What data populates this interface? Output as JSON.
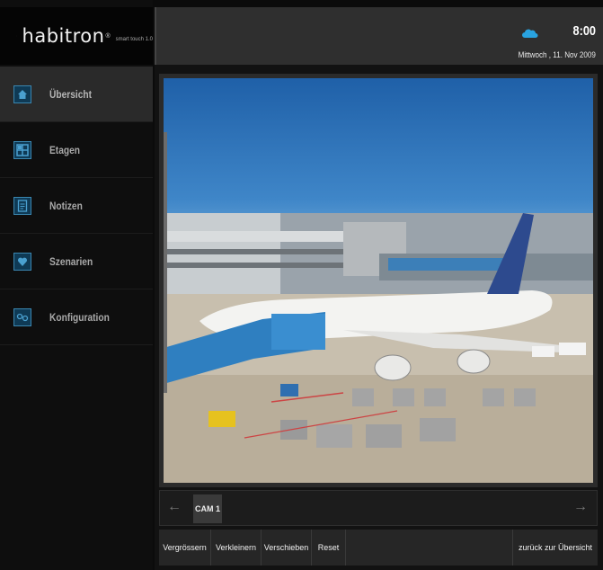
{
  "app": {
    "logo_text": "habitron",
    "logo_reg": "®",
    "logo_sub": "smart touch 1.0"
  },
  "sidebar": {
    "items": [
      {
        "label": "Übersicht",
        "icon": "home-icon",
        "active": true
      },
      {
        "label": "Etagen",
        "icon": "floorplan-icon",
        "active": false
      },
      {
        "label": "Notizen",
        "icon": "notes-icon",
        "active": false
      },
      {
        "label": "Szenarien",
        "icon": "heart-icon",
        "active": false
      },
      {
        "label": "Konfiguration",
        "icon": "config-icon",
        "active": false
      }
    ]
  },
  "header": {
    "weather_icon": "cloud-icon",
    "time": "8:00",
    "date": "Mittwoch , 11. Nov 2009"
  },
  "camera": {
    "tabs": [
      "CAM 1"
    ],
    "prev_icon": "arrow-left-icon",
    "next_icon": "arrow-right-icon"
  },
  "toolbar": {
    "zoom_in": "Vergrössern",
    "zoom_out": "Verkleinern",
    "pan": "Verschieben",
    "reset": "Reset",
    "back": "zurück zur Übersicht"
  },
  "colors": {
    "accent": "#3a86b0",
    "icon_bg": "#0f3a55",
    "cloud": "#29a3e0"
  }
}
